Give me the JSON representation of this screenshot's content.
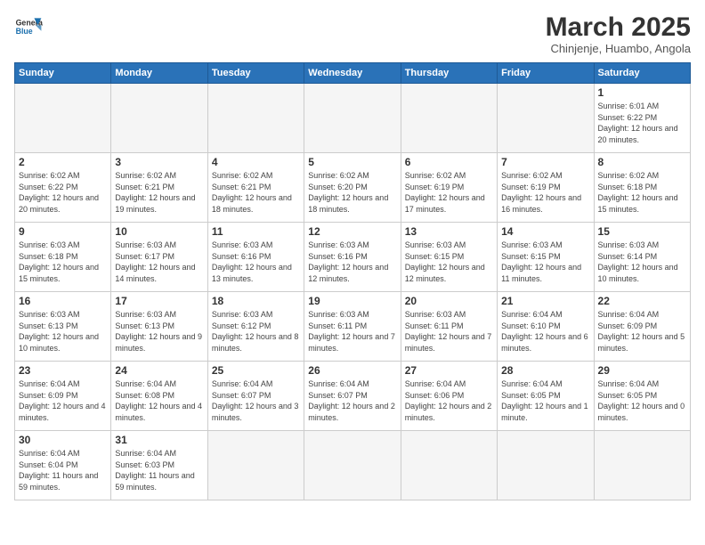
{
  "header": {
    "logo_general": "General",
    "logo_blue": "Blue",
    "month_title": "March 2025",
    "subtitle": "Chinjenje, Huambo, Angola"
  },
  "days_of_week": [
    "Sunday",
    "Monday",
    "Tuesday",
    "Wednesday",
    "Thursday",
    "Friday",
    "Saturday"
  ],
  "weeks": [
    [
      {
        "day": "",
        "info": ""
      },
      {
        "day": "",
        "info": ""
      },
      {
        "day": "",
        "info": ""
      },
      {
        "day": "",
        "info": ""
      },
      {
        "day": "",
        "info": ""
      },
      {
        "day": "",
        "info": ""
      },
      {
        "day": "1",
        "info": "Sunrise: 6:01 AM\nSunset: 6:22 PM\nDaylight: 12 hours and 20 minutes."
      }
    ],
    [
      {
        "day": "2",
        "info": "Sunrise: 6:02 AM\nSunset: 6:22 PM\nDaylight: 12 hours and 20 minutes."
      },
      {
        "day": "3",
        "info": "Sunrise: 6:02 AM\nSunset: 6:21 PM\nDaylight: 12 hours and 19 minutes."
      },
      {
        "day": "4",
        "info": "Sunrise: 6:02 AM\nSunset: 6:21 PM\nDaylight: 12 hours and 18 minutes."
      },
      {
        "day": "5",
        "info": "Sunrise: 6:02 AM\nSunset: 6:20 PM\nDaylight: 12 hours and 18 minutes."
      },
      {
        "day": "6",
        "info": "Sunrise: 6:02 AM\nSunset: 6:19 PM\nDaylight: 12 hours and 17 minutes."
      },
      {
        "day": "7",
        "info": "Sunrise: 6:02 AM\nSunset: 6:19 PM\nDaylight: 12 hours and 16 minutes."
      },
      {
        "day": "8",
        "info": "Sunrise: 6:02 AM\nSunset: 6:18 PM\nDaylight: 12 hours and 15 minutes."
      }
    ],
    [
      {
        "day": "9",
        "info": "Sunrise: 6:03 AM\nSunset: 6:18 PM\nDaylight: 12 hours and 15 minutes."
      },
      {
        "day": "10",
        "info": "Sunrise: 6:03 AM\nSunset: 6:17 PM\nDaylight: 12 hours and 14 minutes."
      },
      {
        "day": "11",
        "info": "Sunrise: 6:03 AM\nSunset: 6:16 PM\nDaylight: 12 hours and 13 minutes."
      },
      {
        "day": "12",
        "info": "Sunrise: 6:03 AM\nSunset: 6:16 PM\nDaylight: 12 hours and 12 minutes."
      },
      {
        "day": "13",
        "info": "Sunrise: 6:03 AM\nSunset: 6:15 PM\nDaylight: 12 hours and 12 minutes."
      },
      {
        "day": "14",
        "info": "Sunrise: 6:03 AM\nSunset: 6:15 PM\nDaylight: 12 hours and 11 minutes."
      },
      {
        "day": "15",
        "info": "Sunrise: 6:03 AM\nSunset: 6:14 PM\nDaylight: 12 hours and 10 minutes."
      }
    ],
    [
      {
        "day": "16",
        "info": "Sunrise: 6:03 AM\nSunset: 6:13 PM\nDaylight: 12 hours and 10 minutes."
      },
      {
        "day": "17",
        "info": "Sunrise: 6:03 AM\nSunset: 6:13 PM\nDaylight: 12 hours and 9 minutes."
      },
      {
        "day": "18",
        "info": "Sunrise: 6:03 AM\nSunset: 6:12 PM\nDaylight: 12 hours and 8 minutes."
      },
      {
        "day": "19",
        "info": "Sunrise: 6:03 AM\nSunset: 6:11 PM\nDaylight: 12 hours and 7 minutes."
      },
      {
        "day": "20",
        "info": "Sunrise: 6:03 AM\nSunset: 6:11 PM\nDaylight: 12 hours and 7 minutes."
      },
      {
        "day": "21",
        "info": "Sunrise: 6:04 AM\nSunset: 6:10 PM\nDaylight: 12 hours and 6 minutes."
      },
      {
        "day": "22",
        "info": "Sunrise: 6:04 AM\nSunset: 6:09 PM\nDaylight: 12 hours and 5 minutes."
      }
    ],
    [
      {
        "day": "23",
        "info": "Sunrise: 6:04 AM\nSunset: 6:09 PM\nDaylight: 12 hours and 4 minutes."
      },
      {
        "day": "24",
        "info": "Sunrise: 6:04 AM\nSunset: 6:08 PM\nDaylight: 12 hours and 4 minutes."
      },
      {
        "day": "25",
        "info": "Sunrise: 6:04 AM\nSunset: 6:07 PM\nDaylight: 12 hours and 3 minutes."
      },
      {
        "day": "26",
        "info": "Sunrise: 6:04 AM\nSunset: 6:07 PM\nDaylight: 12 hours and 2 minutes."
      },
      {
        "day": "27",
        "info": "Sunrise: 6:04 AM\nSunset: 6:06 PM\nDaylight: 12 hours and 2 minutes."
      },
      {
        "day": "28",
        "info": "Sunrise: 6:04 AM\nSunset: 6:05 PM\nDaylight: 12 hours and 1 minute."
      },
      {
        "day": "29",
        "info": "Sunrise: 6:04 AM\nSunset: 6:05 PM\nDaylight: 12 hours and 0 minutes."
      }
    ],
    [
      {
        "day": "30",
        "info": "Sunrise: 6:04 AM\nSunset: 6:04 PM\nDaylight: 11 hours and 59 minutes."
      },
      {
        "day": "31",
        "info": "Sunrise: 6:04 AM\nSunset: 6:03 PM\nDaylight: 11 hours and 59 minutes."
      },
      {
        "day": "",
        "info": ""
      },
      {
        "day": "",
        "info": ""
      },
      {
        "day": "",
        "info": ""
      },
      {
        "day": "",
        "info": ""
      },
      {
        "day": "",
        "info": ""
      }
    ]
  ]
}
